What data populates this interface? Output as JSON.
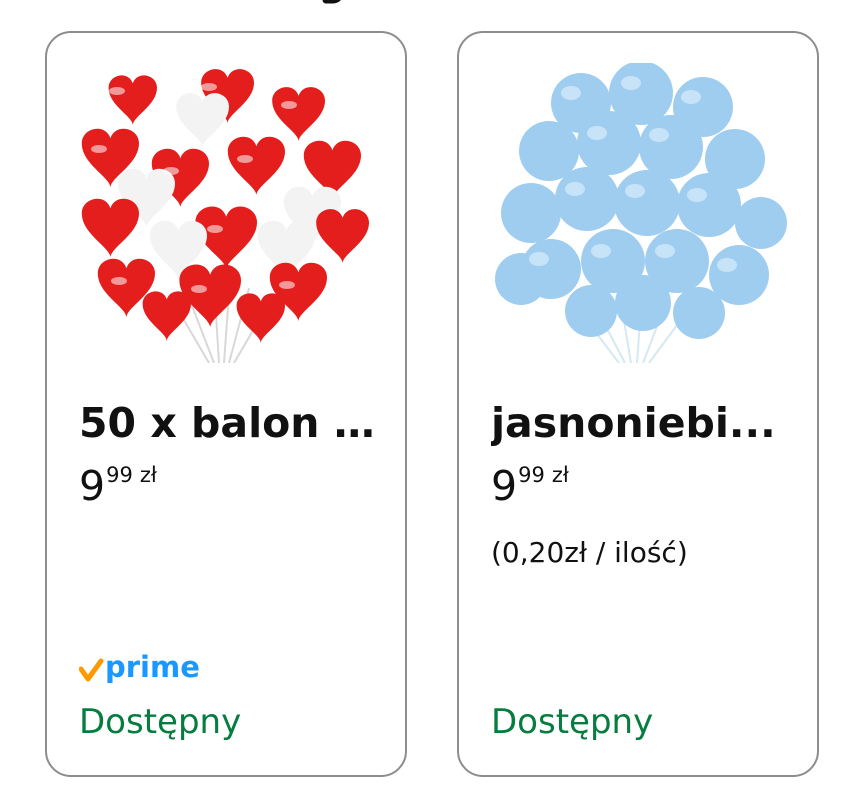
{
  "products": [
    {
      "title": "50 x balon ...",
      "price": {
        "whole": "9",
        "fraction": "99",
        "currency": "zł"
      },
      "unit_price": "",
      "prime": true,
      "prime_label": "prime",
      "availability": "Dostępny",
      "image_icon": "red-white-heart-balloons-icon"
    },
    {
      "title": "jasnoniebi...",
      "price": {
        "whole": "9",
        "fraction": "99",
        "currency": "zł"
      },
      "unit_price": "(0,20zł / ilość)",
      "prime": false,
      "availability": "Dostępny",
      "image_icon": "light-blue-balloons-icon"
    }
  ],
  "colors": {
    "availability": "#067d3f",
    "prime_blue": "#1a98ff",
    "prime_check": "#ff9900",
    "border": "#8d8d8d"
  }
}
